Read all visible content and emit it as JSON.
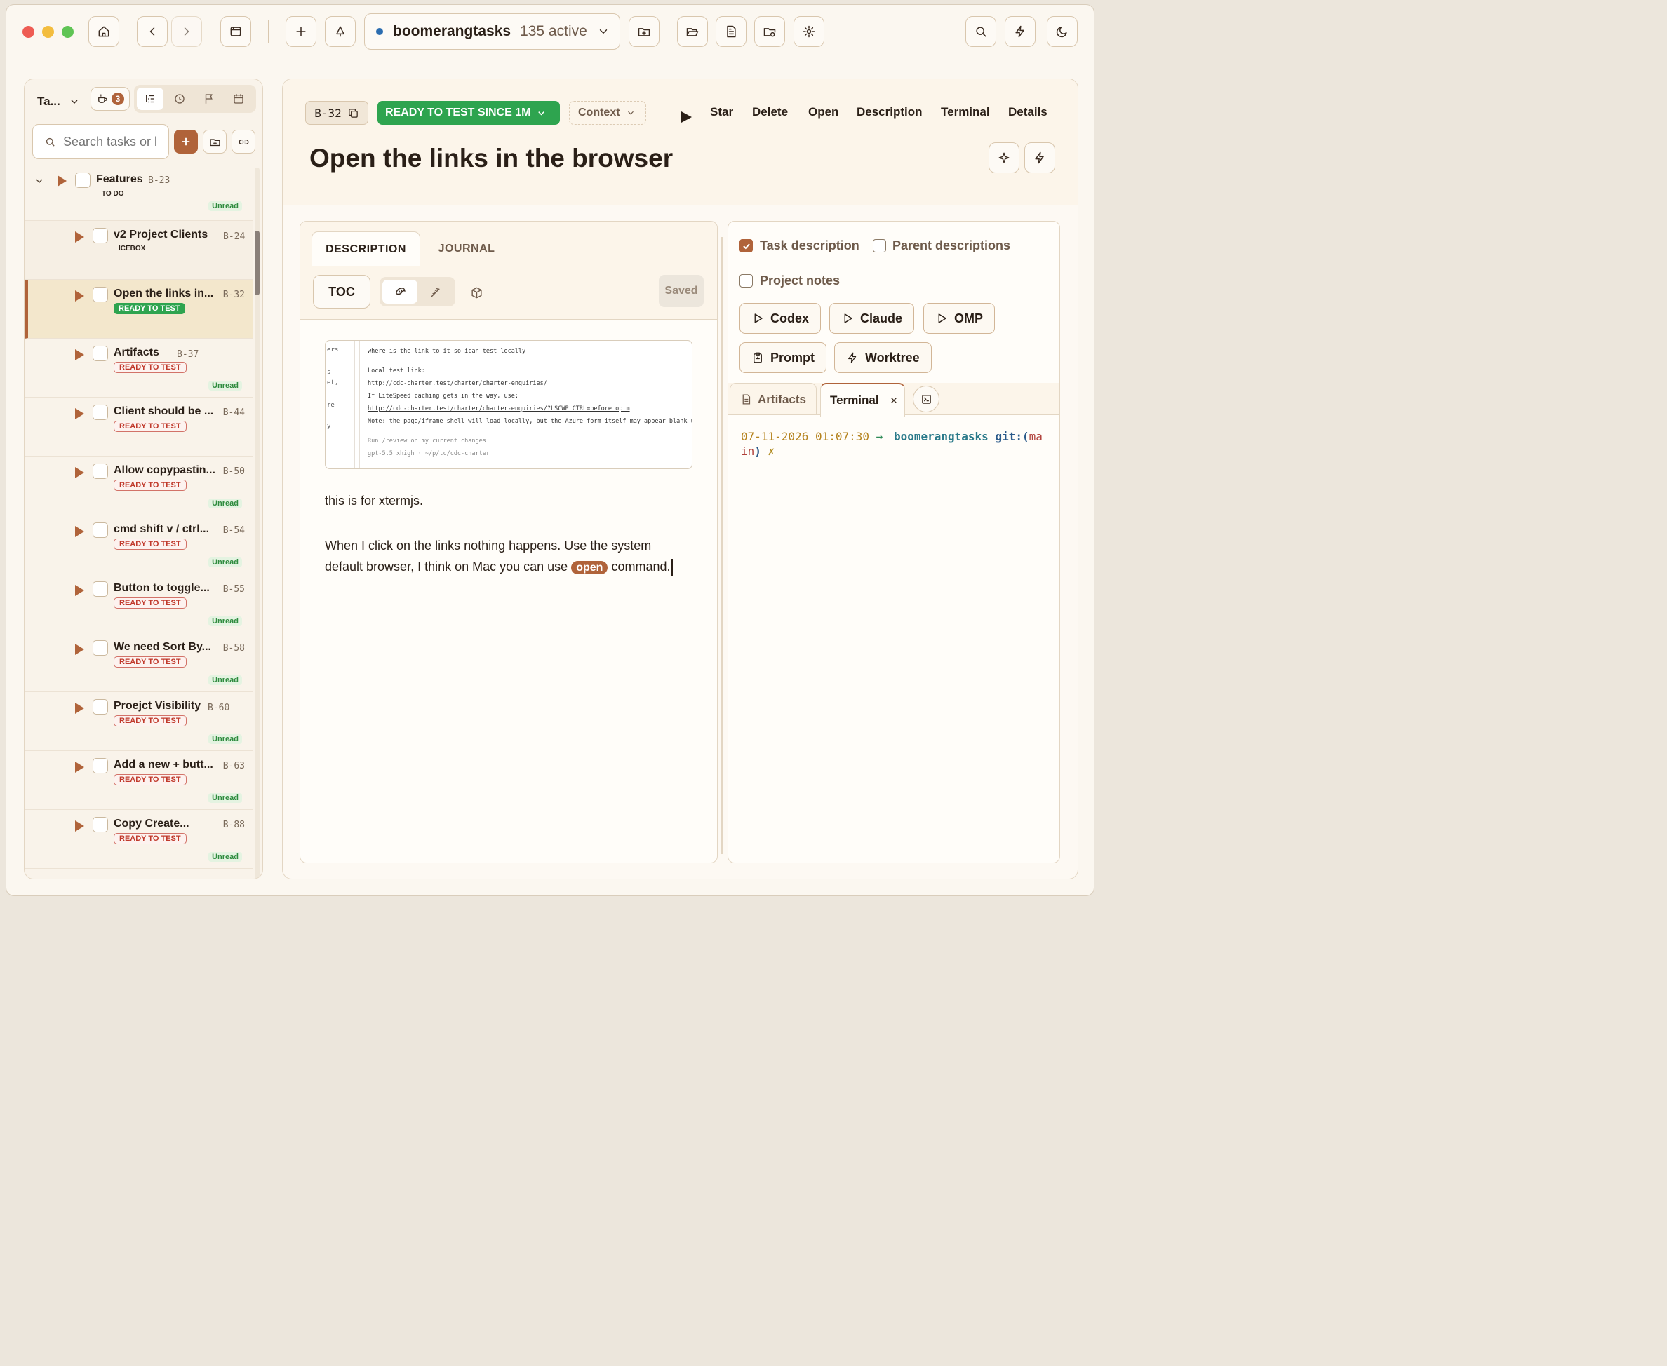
{
  "titlebar": {
    "project_name": "boomerangtasks",
    "active_count": "135 active"
  },
  "sidebar": {
    "view_selector": "Ta...",
    "coffee_count": "3",
    "search_placeholder": "Search tasks or l",
    "parent": {
      "title": "Features",
      "code": "B-23",
      "status": "TO DO",
      "unread": "Unread"
    },
    "tasks": [
      {
        "title": "v2 Project Clients",
        "code": "B-24",
        "status": "ICEBOX",
        "unread": ""
      },
      {
        "title": "Open the links in...",
        "code": "B-32",
        "status": "READY TO TEST",
        "unread": ""
      },
      {
        "title": "Artifacts",
        "code": "B-37",
        "status": "READY TO TEST",
        "unread": "Unread"
      },
      {
        "title": "Client should be ...",
        "code": "B-44",
        "status": "READY TO TEST",
        "unread": ""
      },
      {
        "title": "Allow copypastin...",
        "code": "B-50",
        "status": "READY TO TEST",
        "unread": "Unread"
      },
      {
        "title": "cmd shift v / ctrl...",
        "code": "B-54",
        "status": "READY TO TEST",
        "unread": "Unread"
      },
      {
        "title": "Button to toggle...",
        "code": "B-55",
        "status": "READY TO TEST",
        "unread": "Unread"
      },
      {
        "title": "We need Sort By...",
        "code": "B-58",
        "status": "READY TO TEST",
        "unread": "Unread"
      },
      {
        "title": "Proejct Visibility",
        "code": "B-60",
        "status": "READY TO TEST",
        "unread": "Unread"
      },
      {
        "title": "Add a new + butt...",
        "code": "B-63",
        "status": "READY TO TEST",
        "unread": "Unread"
      },
      {
        "title": "Copy Create...",
        "code": "B-88",
        "status": "READY TO TEST",
        "unread": "Unread"
      }
    ]
  },
  "task": {
    "code": "B-32",
    "status": "READY TO TEST SINCE 1M",
    "context": "Context",
    "actions": [
      "Star",
      "Delete",
      "Open",
      "Description",
      "Terminal",
      "Details"
    ],
    "title": "Open the links in the browser"
  },
  "editor": {
    "tabs": [
      "DESCRIPTION",
      "JOURNAL"
    ],
    "toc": "TOC",
    "saved": "Saved",
    "screenshot": {
      "left_fragments": [
        "ers",
        "s",
        "et,",
        "re",
        "y"
      ],
      "lines": [
        "where is the link to it so ican test locally",
        "Local test link:",
        "http://cdc-charter.test/charter/charter-enquiries/",
        "If LiteSpeed caching gets in the way, use:",
        "http://cdc-charter.test/charter/charter-enquiries/?LSCWP_CTRL=before_optm",
        "Note: the page/iframe shell will load locally, but the Azure form itself may appear blank until th",
        "Run /review on my current changes",
        "gpt-5.5 xhigh · ~/p/tc/cdc-charter"
      ]
    },
    "paragraph1": "this is for xtermjs.",
    "paragraph2_a": "When I click on the links nothing happens. Use the system default browser, I think on Mac you can use",
    "inline_code": "open",
    "paragraph2_b": "command."
  },
  "context_panel": {
    "options": [
      {
        "label": "Task description",
        "checked": true
      },
      {
        "label": "Parent descriptions",
        "checked": false
      },
      {
        "label": "Project notes",
        "checked": false
      }
    ],
    "agents": [
      "Codex",
      "Claude",
      "OMP"
    ],
    "tools": [
      "Prompt",
      "Worktree"
    ],
    "tabs": [
      "Artifacts",
      "Terminal"
    ],
    "terminal": {
      "timestamp": "07-11-2026 01:07:30",
      "arrow": "→",
      "dir": "boomerangtasks",
      "git_label": "git:(",
      "branch_a": "ma",
      "branch_b": "in",
      "close_paren": ")",
      "dirty": "✗"
    }
  },
  "colors": {
    "accent": "#b0633a",
    "ready_green": "#2ea44f",
    "ready_red": "#c0392b",
    "background": "#fbf7f0"
  }
}
